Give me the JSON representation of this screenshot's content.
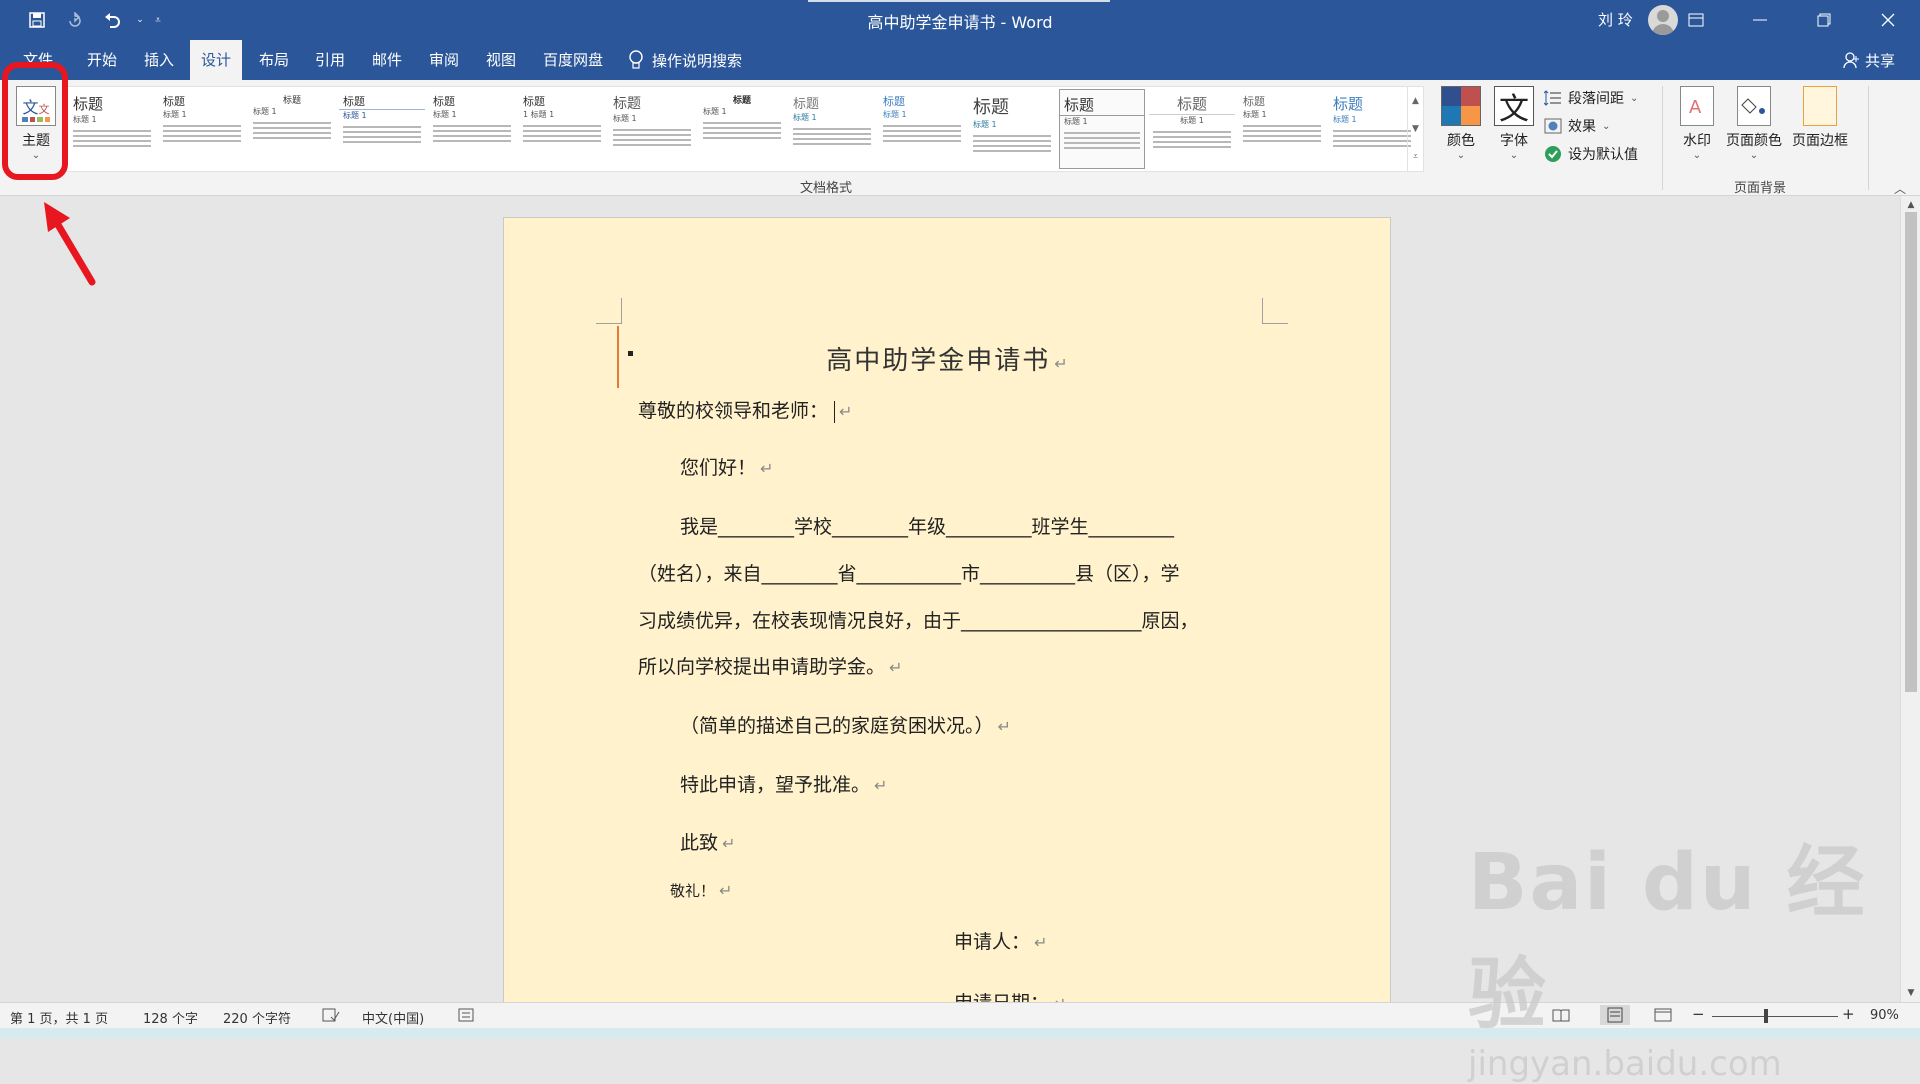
{
  "window": {
    "title": "高中助学金申请书 - Word",
    "user_name": "刘 玲",
    "controls": [
      "restore-ribbon",
      "minimize",
      "maximize",
      "close"
    ]
  },
  "qat": {
    "save_icon": "save-icon",
    "redo_icon": "redo-icon",
    "undo_icon": "undo-icon"
  },
  "tabs": {
    "file": "文件",
    "items": [
      "开始",
      "插入",
      "设计",
      "布局",
      "引用",
      "邮件",
      "审阅",
      "视图",
      "百度网盘"
    ],
    "active": "设计",
    "tell_me": "操作说明搜索",
    "share": "共享"
  },
  "ribbon": {
    "theme_label": "主题",
    "gallery_group_label": "文档格式",
    "style_items": [
      {
        "heading": "标题",
        "sub": "标题 1"
      },
      {
        "heading": "标题",
        "sub": "标题 1"
      },
      {
        "heading": "标题",
        "sub": "标题 1"
      },
      {
        "heading": "标题",
        "sub": "标题 1"
      },
      {
        "heading": "标题",
        "sub": "标题 1"
      },
      {
        "heading": "标题",
        "sub": "1 标题 1"
      },
      {
        "heading": "标题",
        "sub": "标题 1"
      },
      {
        "heading": "标题",
        "sub": "标题 1"
      },
      {
        "heading": "标题",
        "sub": "标题 1"
      },
      {
        "heading": "标题",
        "sub": "标题 1"
      },
      {
        "heading": "标题",
        "sub": "标题 1"
      },
      {
        "heading": "标题",
        "sub": "标题 1"
      },
      {
        "heading": "标题",
        "sub": "标题 1"
      },
      {
        "heading": "标题",
        "sub": "标题 1"
      },
      {
        "heading": "标题",
        "sub": "标题 1"
      }
    ],
    "colors_label": "颜色",
    "fonts_label": "字体",
    "font_icon_glyph": "文",
    "paragraph_spacing_label": "段落间距",
    "effects_label": "效果",
    "set_default_label": "设为默认值",
    "watermark_label": "水印",
    "page_color_label": "页面颜色",
    "page_borders_label": "页面边框",
    "page_bg_group_label": "页面背景"
  },
  "document": {
    "title": "高中助学金申请书",
    "greeting": "尊敬的校领导和老师：",
    "hello": "您们好！",
    "line1": "我是________学校________年级_________班学生_________",
    "line2": "（姓名），来自________省___________市__________县（区），学",
    "line3": "习成绩优异，在校表现情况良好，由于___________________原因，",
    "line4": "所以向学校提出申请助学金。",
    "line5": "（简单的描述自己的家庭贫困状况。）",
    "line6": "特此申请，望予批准。",
    "line7": "此致",
    "line8": "敬礼！",
    "line9": "申请人：",
    "line10": "申请日期：",
    "para_mark": "↵"
  },
  "status": {
    "page": "第 1 页，共 1 页",
    "words": "128 个字",
    "chars": "220 个字符",
    "language": "中文(中国)",
    "zoom": "90%",
    "zoom_minus": "−",
    "zoom_plus": "+"
  },
  "watermark": {
    "brand": "Bai du 经验",
    "url": "jingyan.baidu.com"
  },
  "colors": {
    "word_blue": "#2b579a",
    "page_bg": "#fff2cc",
    "highlight_red": "#e8161e"
  }
}
